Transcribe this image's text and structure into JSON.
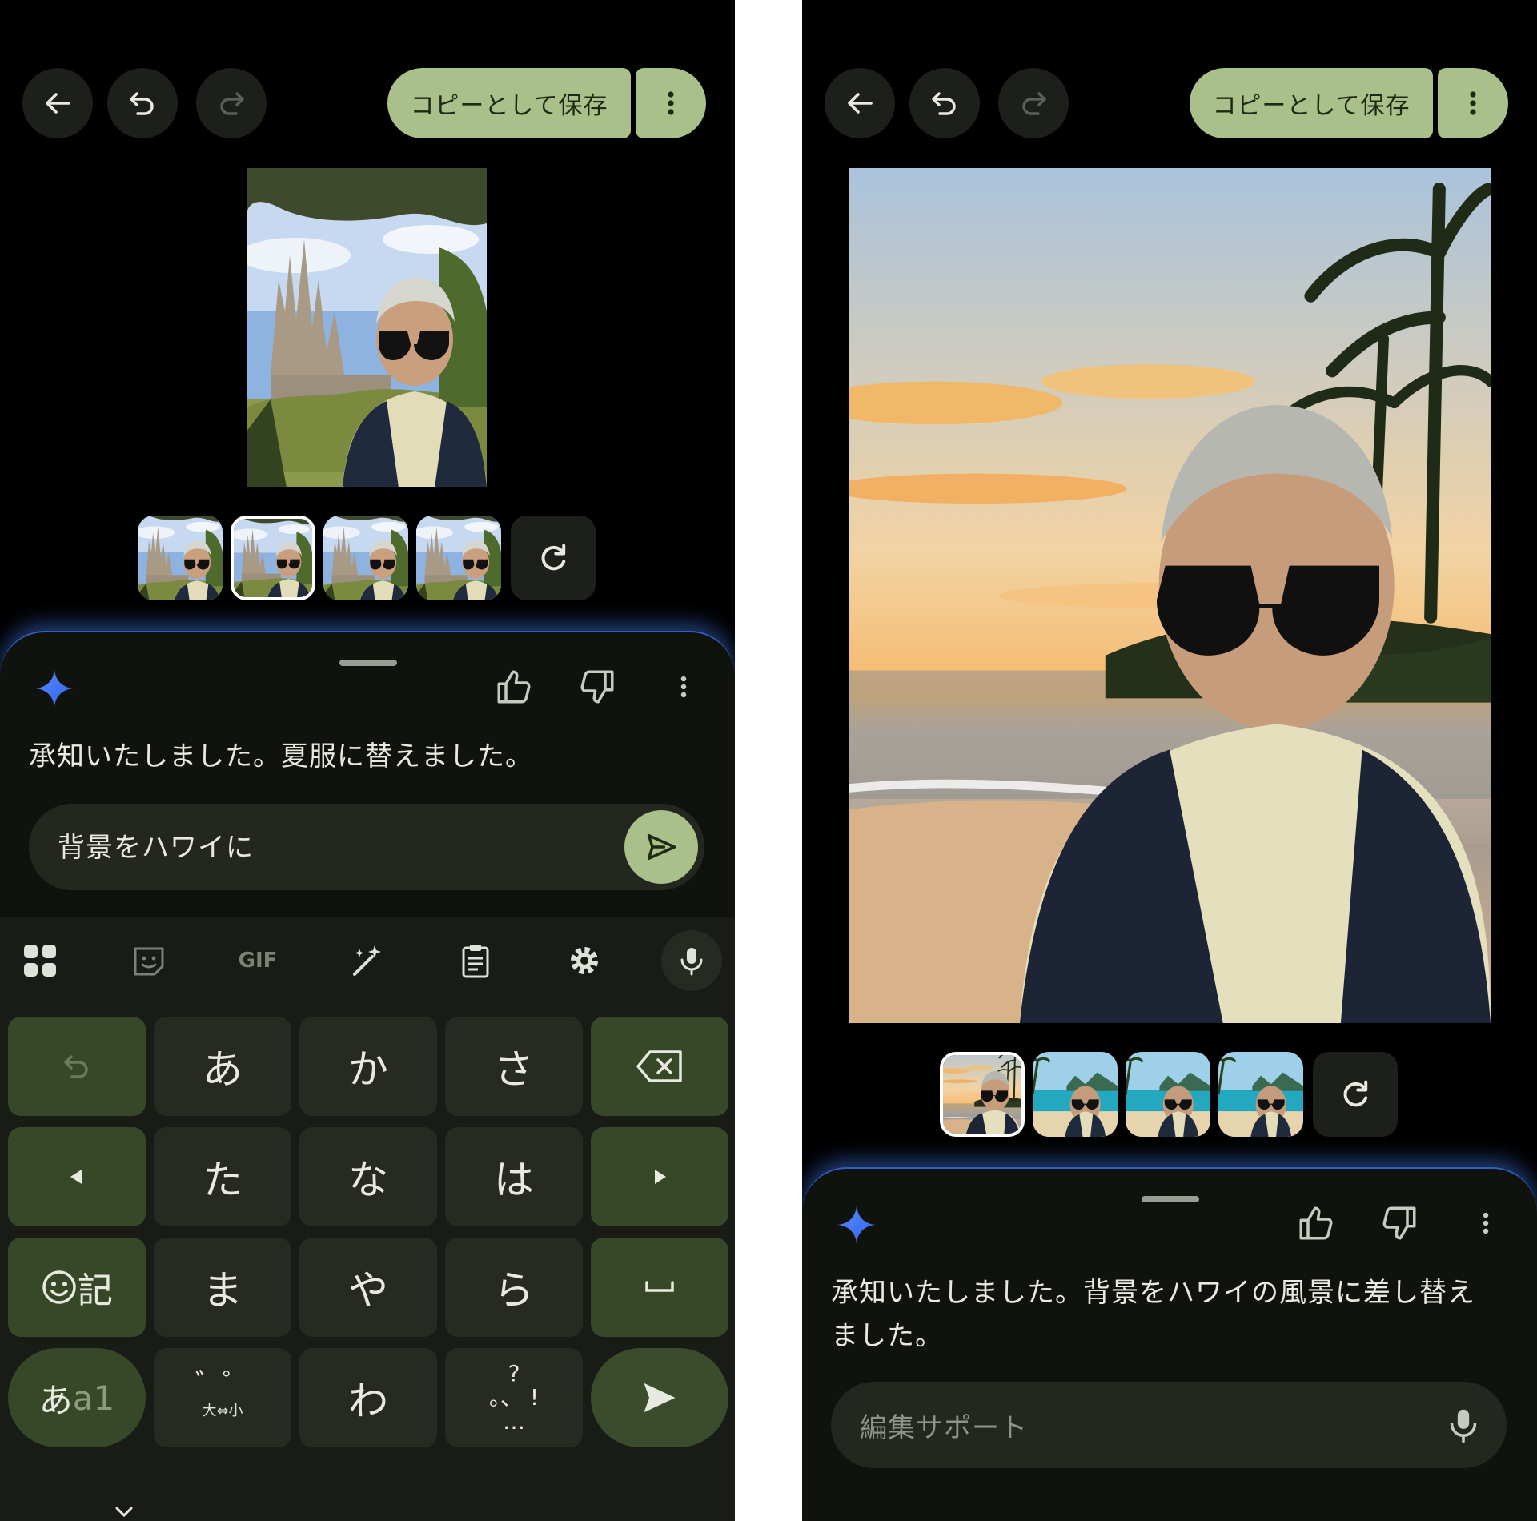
{
  "left": {
    "toolbar": {
      "back_icon": "arrow-left",
      "undo_icon": "undo",
      "redo_icon": "redo",
      "save_label": "コピーとして保存",
      "more_icon": "more-vertical"
    },
    "thumbnails": {
      "count": 4,
      "selected_index": 1,
      "regenerate_icon": "refresh"
    },
    "assistant": {
      "response": "承知いたしました。夏服に替えました。",
      "prompt_value": "背景をハワイに",
      "icons": [
        "sparkle",
        "thumbs-up",
        "thumbs-down",
        "more-vertical",
        "send"
      ]
    },
    "keyboard": {
      "toolbar_icons": [
        "apps-grid",
        "sticker",
        "gif",
        "magic-wand",
        "clipboard",
        "settings",
        "microphone"
      ],
      "gif_label": "GIF",
      "keys": {
        "a": "あ",
        "ka": "か",
        "sa": "さ",
        "ta": "た",
        "na": "な",
        "ha": "は",
        "ma": "ま",
        "ya": "や",
        "ra": "ら",
        "wa": "わ",
        "kigou_label": "記",
        "mode_label_kana": "あ",
        "mode_label_alpha": "a1",
        "dakuten_label": "゛゜",
        "dakuten_sub": "大⇔小",
        "punct_top": "?",
        "punct_mid": "。、 !",
        "punct_bottom": "…"
      },
      "bottom_icon": "chevron-down"
    }
  },
  "right": {
    "toolbar": {
      "back_icon": "arrow-left",
      "undo_icon": "undo",
      "redo_icon": "redo",
      "save_label": "コピーとして保存",
      "more_icon": "more-vertical"
    },
    "thumbnails": {
      "count": 4,
      "selected_index": 0,
      "regenerate_icon": "refresh"
    },
    "assistant": {
      "response_line1": "承知いたしました。背景をハワイの風景に差し替え",
      "response_line2": "ました。",
      "prompt_placeholder": "編集サポート",
      "icons": [
        "sparkle",
        "thumbs-up",
        "thumbs-down",
        "more-vertical",
        "microphone"
      ]
    }
  },
  "colors": {
    "background": "#000000",
    "accent": "#a9c08a",
    "panel": "#10130d",
    "key": "#262a22",
    "function_key": "#374828",
    "glow": "#3b6fd6"
  }
}
